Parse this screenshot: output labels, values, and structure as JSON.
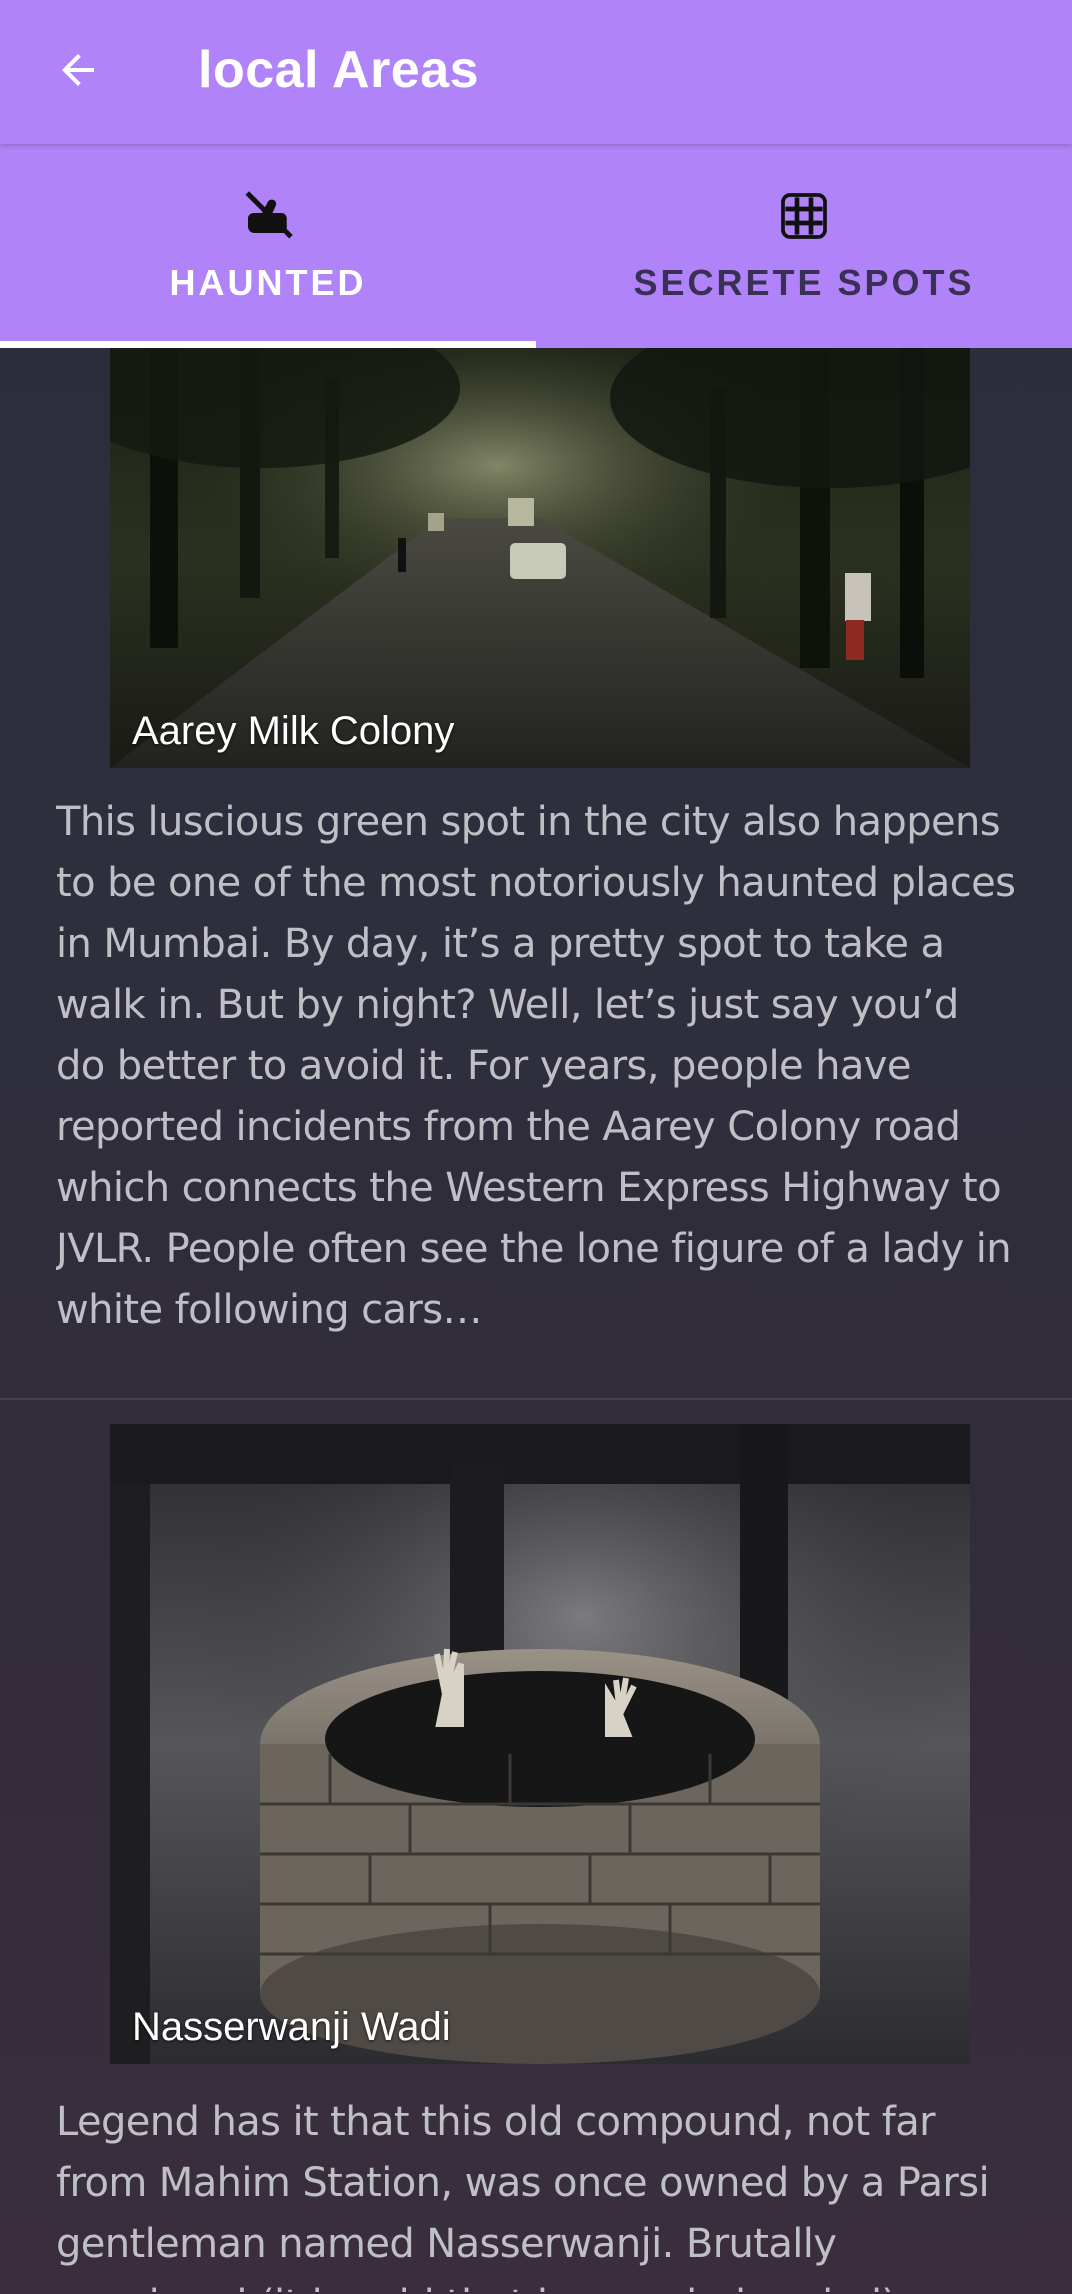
{
  "appbar": {
    "title": "local Areas",
    "back_icon": "arrow-left-icon"
  },
  "tabs": [
    {
      "label": "HAUNTED",
      "icon": "no-touch-icon",
      "active": true
    },
    {
      "label": "SECRETE SPOTS",
      "icon": "grid-icon",
      "active": false
    }
  ],
  "places": [
    {
      "name": "Aarey Milk Colony",
      "description": "This luscious green spot in the city also happens to be one of the most notoriously haunted places in Mumbai. By day, it’s a pretty spot to take a walk in. But by night? Well, let’s just say you’d do better to avoid it. For years, people have reported incidents from the Aarey Colony road which connects the Western Express Highway to JVLR. People often see the lone figure of a lady in white following cars…"
    },
    {
      "name": "Nasserwanji Wadi",
      "description": "Legend has it that this old compound, not far from Mahim Station, was once owned by a Parsi gentleman named Nasserwanji. Brutally murdered (it is said that he was beheaded)…"
    }
  ],
  "colors": {
    "primary": "#b084f8",
    "tab_indicator": "#ffffff",
    "background": "#2e2e3c",
    "description_text": "#bfbfc6"
  }
}
